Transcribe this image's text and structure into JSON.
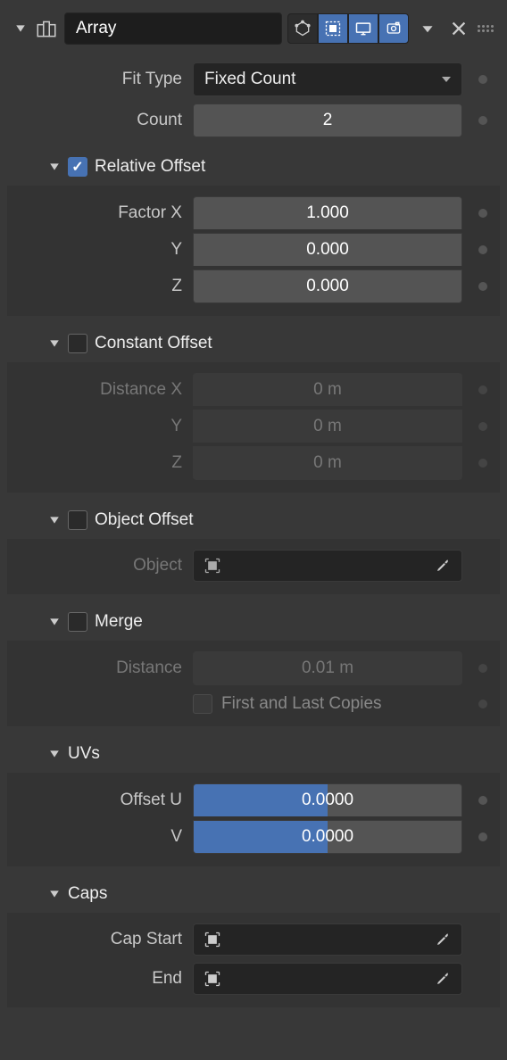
{
  "header": {
    "name": "Array"
  },
  "fit": {
    "type_label": "Fit Type",
    "type_value": "Fixed Count",
    "count_label": "Count",
    "count_value": "2"
  },
  "relative_offset": {
    "title": "Relative Offset",
    "checked": true,
    "factor_x_label": "Factor X",
    "y_label": "Y",
    "z_label": "Z",
    "x": "1.000",
    "y": "0.000",
    "z": "0.000"
  },
  "constant_offset": {
    "title": "Constant Offset",
    "checked": false,
    "dist_x_label": "Distance X",
    "y_label": "Y",
    "z_label": "Z",
    "x": "0 m",
    "y": "0 m",
    "z": "0 m"
  },
  "object_offset": {
    "title": "Object Offset",
    "checked": false,
    "object_label": "Object",
    "object_value": ""
  },
  "merge": {
    "title": "Merge",
    "checked": false,
    "distance_label": "Distance",
    "distance_value": "0.01 m",
    "first_last_label": "First and Last Copies"
  },
  "uvs": {
    "title": "UVs",
    "u_label": "Offset U",
    "v_label": "V",
    "u": "0.0000",
    "v": "0.0000"
  },
  "caps": {
    "title": "Caps",
    "start_label": "Cap Start",
    "end_label": "End",
    "start_value": "",
    "end_value": ""
  }
}
